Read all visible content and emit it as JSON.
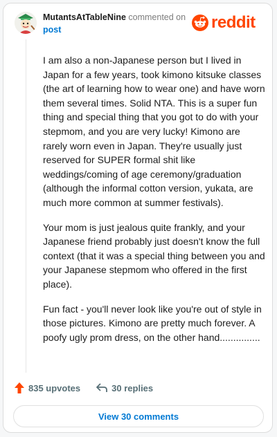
{
  "header": {
    "username": "MutantsAtTableNine",
    "commented_on": "commented on",
    "post_link": "post",
    "brand": "reddit"
  },
  "comment": {
    "paragraphs": [
      "I am also a non-Japanese person but I lived in Japan for a few years, took kimono kitsuke classes (the art of learning how to wear one) and have worn them several times. Solid NTA. This is a super fun thing and special thing that you got to do with your stepmom, and you are very lucky! Kimono are rarely worn even in Japan. They're usually just reserved for SUPER formal shit like weddings/coming of age ceremony/graduation (although the informal cotton version, yukata, are much more common at summer festivals).",
      "Your mom is just jealous quite frankly, and your Japanese friend probably just doesn't know the full context (that it was a special thing between you and your Japanese stepmom who offered in the first place).",
      "Fun fact - you'll never look like you're out of style in those pictures. Kimono are pretty much forever. A poofy ugly prom dress, on the other hand..............."
    ]
  },
  "actions": {
    "upvotes": "835 upvotes",
    "replies": "30 replies"
  },
  "footer": {
    "view_comments": "View 30 comments"
  },
  "colors": {
    "brand": "#ff4500",
    "link": "#0079d3",
    "text": "#1c1c1c",
    "muted": "#576f76"
  },
  "icons": {
    "upvote": "upvote-arrow-icon",
    "reply": "reply-arrow-icon",
    "logo": "reddit-snoo-icon"
  }
}
